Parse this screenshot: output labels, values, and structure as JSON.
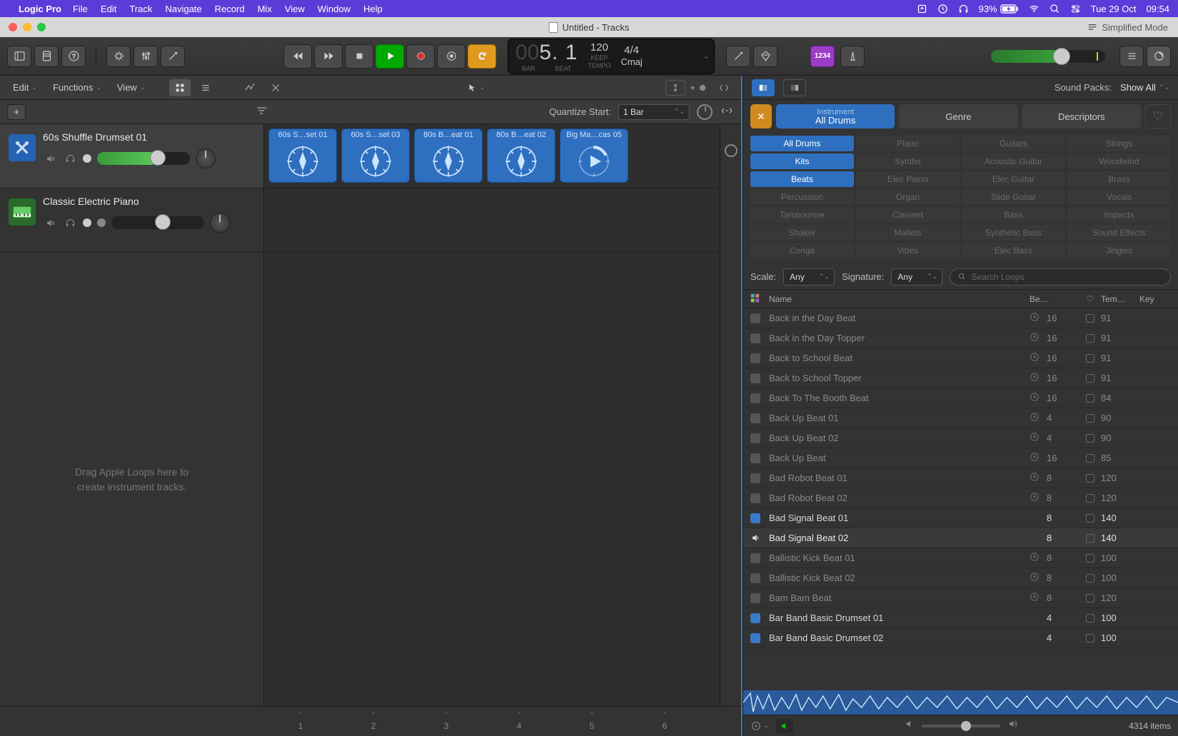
{
  "menubar": {
    "app": "Logic Pro",
    "items": [
      "File",
      "Edit",
      "Track",
      "Navigate",
      "Record",
      "Mix",
      "View",
      "Window",
      "Help"
    ],
    "battery": "93%",
    "date": "Tue 29 Oct",
    "time": "09:54"
  },
  "titlebar": {
    "title": "Untitled - Tracks",
    "mode_label": "Simplified Mode"
  },
  "lcd": {
    "position_prefix": "00",
    "position": "5. 1",
    "bar_label": "BAR",
    "beat_label": "BEAT",
    "tempo": "120",
    "tempo_sub": "KEEP",
    "tempo_label": "TEMPO",
    "sig": "4/4",
    "key": "Cmaj"
  },
  "count_in": "1234",
  "subtoolbar": {
    "edit": "Edit",
    "functions": "Functions",
    "view": "View"
  },
  "quantize": {
    "label": "Quantize Start:",
    "value": "1 Bar"
  },
  "tracks": [
    {
      "name": "60s Shuffle Drumset 01",
      "color": "blue",
      "icon": "drum",
      "fader": 65
    },
    {
      "name": "Classic Electric Piano",
      "color": "green",
      "icon": "keyboard",
      "fader": 55
    }
  ],
  "drop_hint_l1": "Drag Apple Loops here to",
  "drop_hint_l2": "create instrument tracks.",
  "cells": [
    "60s S…set 01",
    "60s S…set 03",
    "80s B…eat 01",
    "80s B…eat 02",
    "Big Ma…cas 05"
  ],
  "columns": [
    "1",
    "2",
    "3",
    "4",
    "5",
    "6"
  ],
  "loop_browser": {
    "sound_packs_label": "Sound Packs:",
    "show_all": "Show All",
    "filter_tabs": {
      "instrument_sub": "Instrument",
      "instrument": "All Drums",
      "genre": "Genre",
      "descriptors": "Descriptors"
    },
    "tags_selected": [
      "All Drums",
      "Kits",
      "Beats"
    ],
    "tag_grid": [
      [
        "All Drums",
        "Piano",
        "Guitars",
        "Strings"
      ],
      [
        "Kits",
        "Synths",
        "Acoustic Guitar",
        "Woodwind"
      ],
      [
        "Beats",
        "Elec Piano",
        "Elec Guitar",
        "Brass"
      ],
      [
        "Percussion",
        "Organ",
        "Slide Guitar",
        "Vocals"
      ],
      [
        "Tambourine",
        "Clavinet",
        "Bass",
        "Impacts"
      ],
      [
        "Shaker",
        "Mallets",
        "Synthetic Bass",
        "Sound Effects"
      ],
      [
        "Conga",
        "Vibes",
        "Elec Bass",
        "Jingles"
      ]
    ],
    "scale_label": "Scale:",
    "scale_value": "Any",
    "sig_label": "Signature:",
    "sig_value": "Any",
    "search_placeholder": "Search Loops",
    "columns": {
      "name": "Name",
      "beats": "Be…",
      "tempo": "Tem…",
      "key": "Key"
    },
    "loops": [
      {
        "name": "Back in the Day Beat",
        "beats": "16",
        "tempo": "91",
        "dl": true,
        "avail": false,
        "icon": "blue"
      },
      {
        "name": "Back in the Day Topper",
        "beats": "16",
        "tempo": "91",
        "dl": true,
        "avail": false,
        "icon": "blue"
      },
      {
        "name": "Back to School Beat",
        "beats": "16",
        "tempo": "91",
        "dl": true,
        "avail": false,
        "icon": "blue"
      },
      {
        "name": "Back to School Topper",
        "beats": "16",
        "tempo": "91",
        "dl": true,
        "avail": false,
        "icon": "blue"
      },
      {
        "name": "Back To The Booth Beat",
        "beats": "16",
        "tempo": "84",
        "dl": true,
        "avail": false,
        "icon": "blue"
      },
      {
        "name": "Back Up Beat 01",
        "beats": "4",
        "tempo": "90",
        "dl": true,
        "avail": false,
        "icon": "purple"
      },
      {
        "name": "Back Up Beat 02",
        "beats": "4",
        "tempo": "90",
        "dl": true,
        "avail": false,
        "icon": "purple"
      },
      {
        "name": "Back Up Beat",
        "beats": "16",
        "tempo": "85",
        "dl": true,
        "avail": false,
        "icon": "blue"
      },
      {
        "name": "Bad Robot Beat 01",
        "beats": "8",
        "tempo": "120",
        "dl": true,
        "avail": false,
        "icon": "blue"
      },
      {
        "name": "Bad Robot Beat 02",
        "beats": "8",
        "tempo": "120",
        "dl": true,
        "avail": false,
        "icon": "blue"
      },
      {
        "name": "Bad Signal Beat 01",
        "beats": "8",
        "tempo": "140",
        "dl": false,
        "avail": true,
        "icon": "blue"
      },
      {
        "name": "Bad Signal Beat 02",
        "beats": "8",
        "tempo": "140",
        "dl": false,
        "avail": true,
        "icon": "blue",
        "playing": true
      },
      {
        "name": "Ballistic Kick Beat 01",
        "beats": "8",
        "tempo": "100",
        "dl": true,
        "avail": false,
        "icon": "blue"
      },
      {
        "name": "Ballistic Kick Beat 02",
        "beats": "8",
        "tempo": "100",
        "dl": true,
        "avail": false,
        "icon": "blue"
      },
      {
        "name": "Bam Bam Beat",
        "beats": "8",
        "tempo": "120",
        "dl": true,
        "avail": false,
        "icon": "blue"
      },
      {
        "name": "Bar Band Basic Drumset 01",
        "beats": "4",
        "tempo": "100",
        "dl": false,
        "avail": true,
        "icon": "blue"
      },
      {
        "name": "Bar Band Basic Drumset 02",
        "beats": "4",
        "tempo": "100",
        "dl": false,
        "avail": true,
        "icon": "blue"
      }
    ],
    "item_count": "4314 items"
  }
}
